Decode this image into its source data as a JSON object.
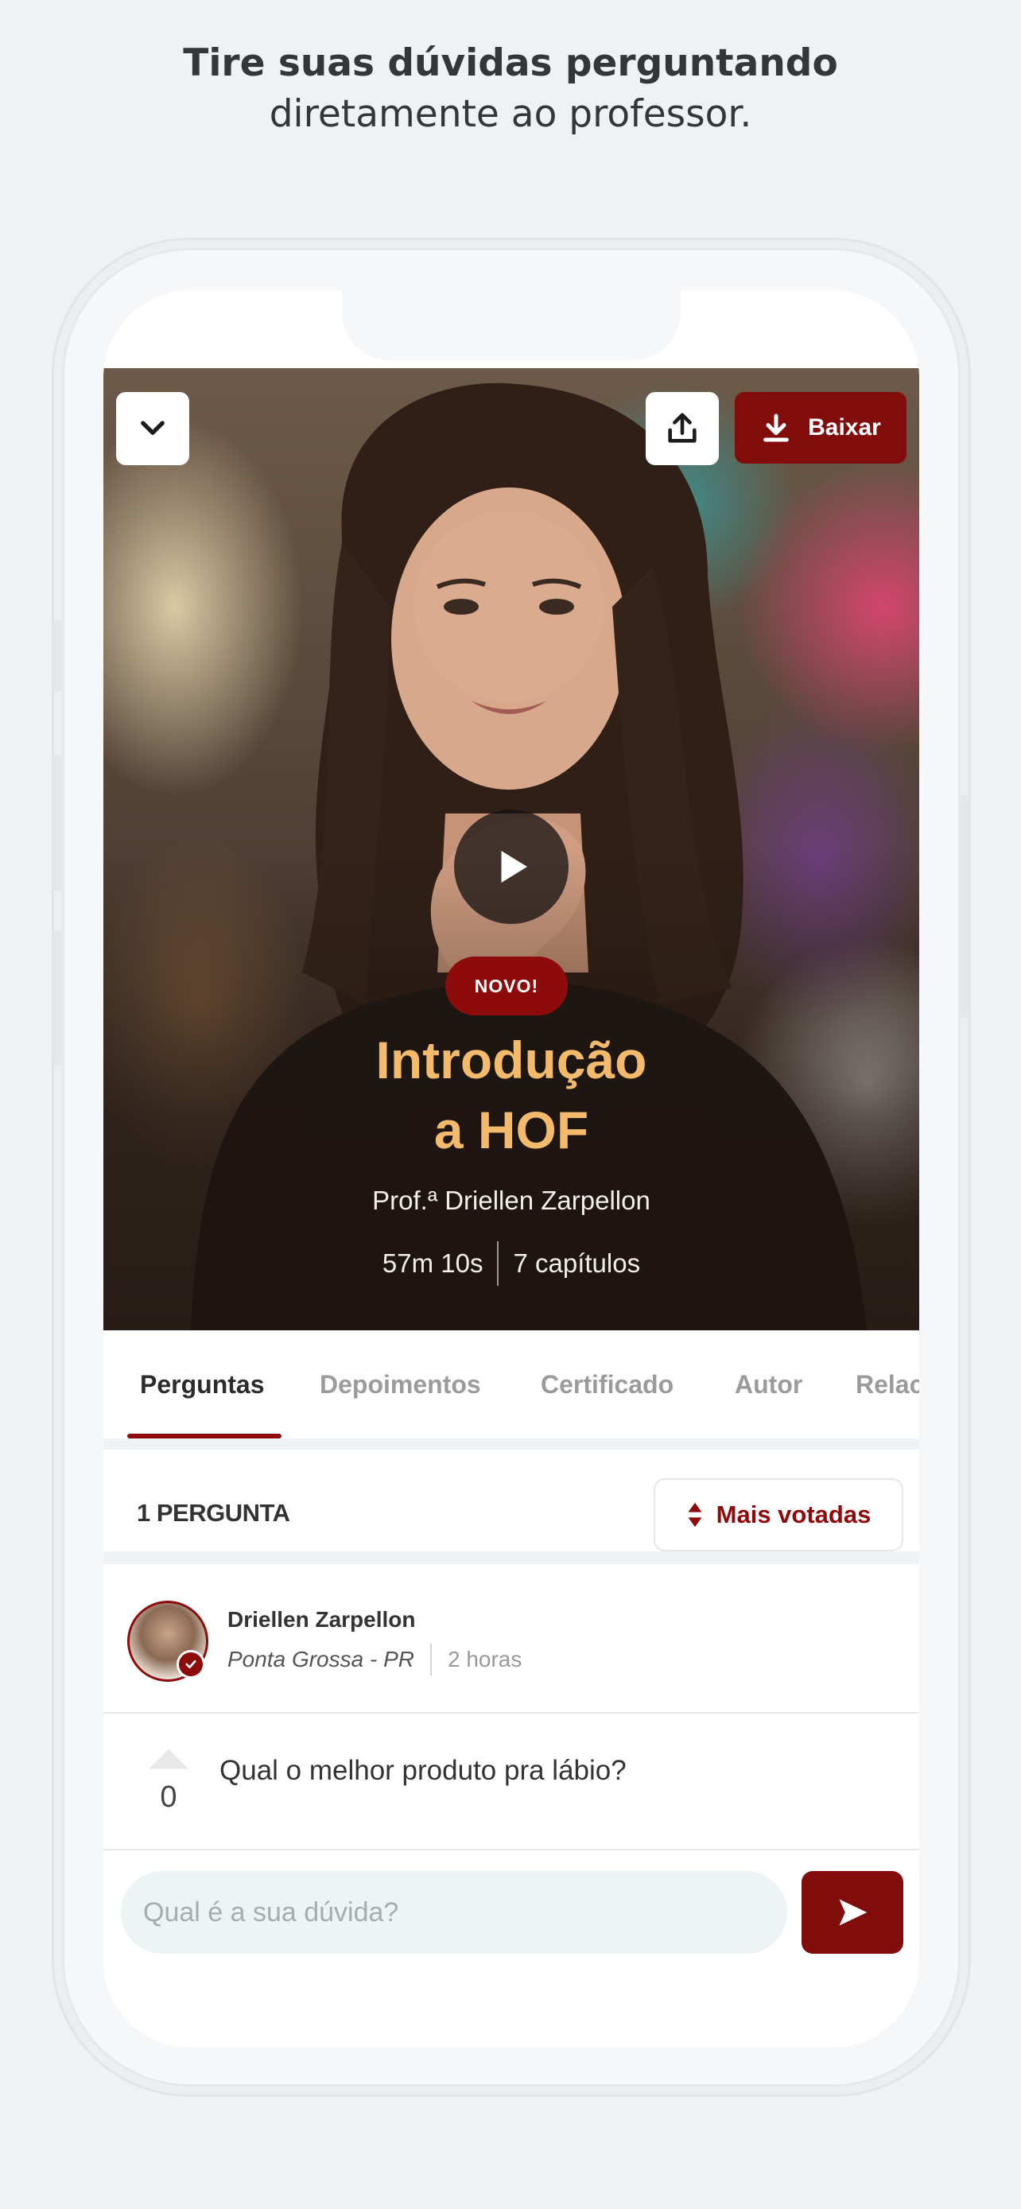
{
  "promo": {
    "headline_bold": "Tire suas dúvidas perguntando",
    "headline_regular": "diretamente ao professor."
  },
  "hero": {
    "download_label": "Baixar",
    "badge": "NOVO!",
    "title_line1": "Introdução",
    "title_line2": "a HOF",
    "author": "Prof.ª Driellen Zarpellon",
    "duration": "57m 10s",
    "chapters": "7 capítulos"
  },
  "tabs": [
    {
      "label": "Perguntas",
      "active": true
    },
    {
      "label": "Depoimentos",
      "active": false
    },
    {
      "label": "Certificado",
      "active": false
    },
    {
      "label": "Autor",
      "active": false
    },
    {
      "label": "Relac",
      "active": false
    }
  ],
  "questions": {
    "count_label": "1 PERGUNTA",
    "sort_label": "Mais votadas",
    "items": [
      {
        "author": "Driellen Zarpellon",
        "location": "Ponta Grossa - PR",
        "time": "2 horas",
        "votes": "0",
        "text": "Qual o melhor produto pra lábio?"
      }
    ]
  },
  "input": {
    "placeholder": "Qual é a sua dúvida?"
  },
  "colors": {
    "brand": "#820b0b",
    "title_gold": "#f2ba6a",
    "background": "#eff1f4"
  }
}
